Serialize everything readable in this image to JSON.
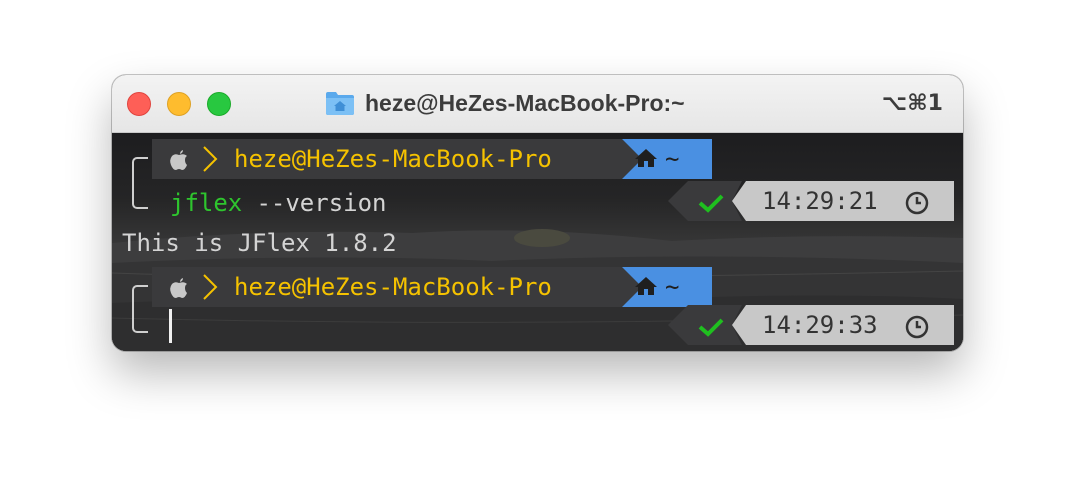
{
  "window": {
    "title": "heze@HeZes-MacBook-Pro:~",
    "shortcut": "⌥⌘1",
    "controls": {
      "close": "close",
      "minimize": "minimize",
      "zoom": "zoom"
    },
    "icon": "folder-home-icon"
  },
  "prompt1": {
    "os_icon": "apple-icon",
    "user_host": "heze@HeZes-MacBook-Pro",
    "dir_icon": "home-icon",
    "dir": "~",
    "command": "jflex",
    "args": " --version",
    "status_icon": "checkmark-icon",
    "time": "14:29:21",
    "time_icon": "clock-icon"
  },
  "output": {
    "line1": "This is JFlex 1.8.2"
  },
  "prompt2": {
    "os_icon": "apple-icon",
    "user_host": "heze@HeZes-MacBook-Pro",
    "dir_icon": "home-icon",
    "dir": "~",
    "status_icon": "checkmark-icon",
    "time": "14:29:33",
    "time_icon": "clock-icon"
  },
  "colors": {
    "segment_dark": "#3a3a3c",
    "segment_blue": "#4a90e2",
    "segment_gray": "#c8c8c8",
    "user_yellow": "#f5c200",
    "command_green": "#2ec52e",
    "check_green": "#1fbf1f",
    "output_text": "#d4d4d4"
  }
}
